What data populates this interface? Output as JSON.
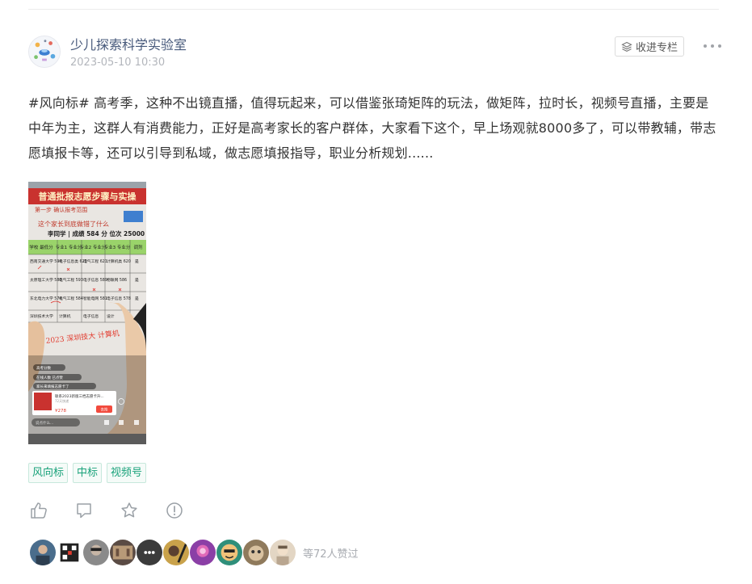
{
  "post": {
    "author": "少儿探索科学实验室",
    "time": "2023-05-10 10:30",
    "collect_label": "收进专栏",
    "content": "#风向标# 高考季，这种不出镜直播，值得玩起来，可以借鉴张琦矩阵的玩法，做矩阵，拉时长，视频号直播，主要是中年为主，这群人有消费能力，正好是高考家长的客户群体，大家看下这个，早上场观就8000多了，可以带教辅，带志愿填报卡等，还可以引导到私域，做志愿填报指导，职业分析规划......",
    "image": {
      "banner": "普通批报志愿步骤与实操",
      "step": "第一步 确认报考范围",
      "question": "这个家长到底做错了什么",
      "student": "李同学 | 成绩 584 分 位次 25000",
      "table_headers": [
        "学校\n最低分",
        "专业1\n专业分",
        "专业2\n专业分",
        "专业3\n专业分",
        "调剂"
      ],
      "table_rows": [
        [
          "西南交通大学 594",
          "电子信息类 620",
          "电气工程 621",
          "计算机类 620",
          "是"
        ],
        [
          "太原理工大学 580",
          "电气工程 593",
          "电子信息 589",
          "物联网 586",
          "是"
        ],
        [
          "东北电力大学 574",
          "电气工程 584",
          "智能电网 581",
          "电子信息 578",
          "是"
        ],
        [
          "深圳技术大学",
          "计算机",
          "电子信息",
          "设计",
          ""
        ]
      ],
      "handwriting": "2023 深圳技大 计算机",
      "comment1": "高考分数",
      "comment2": "在线人数 已点赞",
      "comment3": "家长来填报志愿卡了",
      "product_title": "联系2023新版三档志愿卡升...",
      "product_sub": "72天快递",
      "product_price": "¥278",
      "product_btn": "去抢",
      "chat_hint": "说点什么..."
    },
    "tags": [
      "风向标",
      "中标",
      "视频号"
    ],
    "actions": [
      "like-icon",
      "comment-icon",
      "star-icon",
      "report-icon"
    ],
    "likes_text": "等72人赞过",
    "liker_colors": [
      "#4a6d8c",
      "#222222",
      "#8a8a8a",
      "#5a4b44",
      "#3b3b3b",
      "#c9a24b",
      "#8b3fa6",
      "#2f8f7a",
      "#8f7a5c",
      "#e3d6c4"
    ]
  }
}
